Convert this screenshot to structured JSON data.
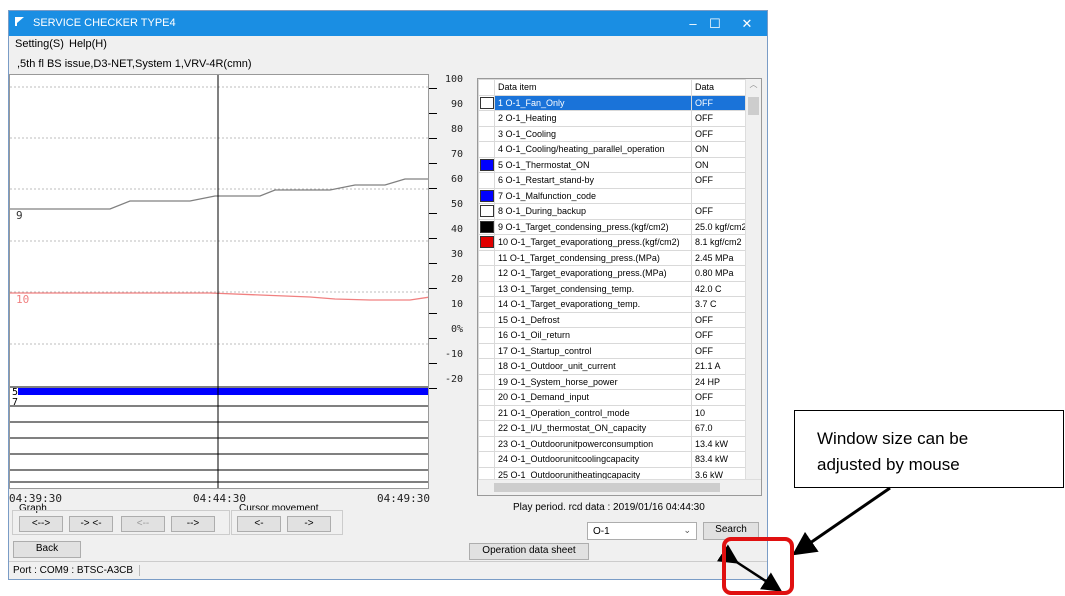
{
  "window": {
    "title": "SERVICE CHECKER TYPE4",
    "controls": [
      "–",
      "☐",
      "✕"
    ]
  },
  "menu": {
    "setting": "Setting(S)",
    "help": "Help(H)"
  },
  "info_line": ",5th fl BS issue,D3-NET,System 1,VRV-4R(cmn)",
  "graph": {
    "y_ticks": [
      "100",
      "90",
      "80",
      "70",
      "60",
      "50",
      "40",
      "30",
      "20",
      "10",
      "0%",
      "-10",
      "-20"
    ],
    "x_labels": [
      "04:39:30",
      "04:44:30",
      "04:49:30"
    ],
    "trace_labels": [
      "9",
      "10",
      "5",
      "7"
    ],
    "colors": {
      "trace9": "#808080",
      "trace10": "#f08080",
      "trace5": "#0000ff"
    }
  },
  "table": {
    "headers": [
      "Data item",
      "Data"
    ],
    "rows": [
      {
        "item": "1 O-1_Fan_Only",
        "value": "OFF",
        "swatch": "#ffffff",
        "selected": true
      },
      {
        "item": "2 O-1_Heating",
        "value": "OFF",
        "swatch": ""
      },
      {
        "item": "3 O-1_Cooling",
        "value": "OFF",
        "swatch": ""
      },
      {
        "item": "4 O-1_Cooling/heating_parallel_operation",
        "value": "ON",
        "swatch": ""
      },
      {
        "item": "5 O-1_Thermostat_ON",
        "value": "ON",
        "swatch": "#0000ff"
      },
      {
        "item": "6 O-1_Restart_stand-by",
        "value": "OFF",
        "swatch": ""
      },
      {
        "item": "7 O-1_Malfunction_code",
        "value": "",
        "swatch": "#0000ff"
      },
      {
        "item": "8 O-1_During_backup",
        "value": "OFF",
        "swatch": "#ffffff"
      },
      {
        "item": "9 O-1_Target_condensing_press.(kgf/cm2)",
        "value": "25.0 kgf/cm2",
        "swatch": "#000000"
      },
      {
        "item": "10 O-1_Target_evaporationg_press.(kgf/cm2)",
        "value": "8.1 kgf/cm2",
        "swatch": "#e00000"
      },
      {
        "item": "11 O-1_Target_condensing_press.(MPa)",
        "value": "2.45 MPa",
        "swatch": ""
      },
      {
        "item": "12 O-1_Target_evaporationg_press.(MPa)",
        "value": "0.80 MPa",
        "swatch": ""
      },
      {
        "item": "13 O-1_Target_condensing_temp.",
        "value": "42.0 C",
        "swatch": ""
      },
      {
        "item": "14 O-1_Target_evaporationg_temp.",
        "value": "3.7 C",
        "swatch": ""
      },
      {
        "item": "15 O-1_Defrost",
        "value": "OFF",
        "swatch": ""
      },
      {
        "item": "16 O-1_Oil_return",
        "value": "OFF",
        "swatch": ""
      },
      {
        "item": "17 O-1_Startup_control",
        "value": "OFF",
        "swatch": ""
      },
      {
        "item": "18 O-1_Outdoor_unit_current",
        "value": "21.1 A",
        "swatch": ""
      },
      {
        "item": "19 O-1_System_horse_power",
        "value": "24 HP",
        "swatch": ""
      },
      {
        "item": "20 O-1_Demand_input",
        "value": "OFF",
        "swatch": ""
      },
      {
        "item": "21 O-1_Operation_control_mode",
        "value": "10",
        "swatch": ""
      },
      {
        "item": "22 O-1_I/U_thermostat_ON_capacity",
        "value": "67.0",
        "swatch": ""
      },
      {
        "item": "23 O-1_Outdoorunitpowerconsumption",
        "value": "13.4 kW",
        "swatch": ""
      },
      {
        "item": "24 O-1_Outdoorunitcoolingcapacity",
        "value": "83.4 kW",
        "swatch": ""
      },
      {
        "item": "25 O-1_Outdoorunitheatingcapacity",
        "value": "3.6 kW",
        "swatch": ""
      }
    ]
  },
  "play_period": "Play period. rcd data : 2019/01/16 04:44:30",
  "graph_controls": {
    "label": "Graph",
    "buttons": [
      "<-->",
      "-> <-",
      "<--",
      "-->"
    ]
  },
  "cursor_controls": {
    "label": "Cursor movement",
    "buttons": [
      "<-",
      "->"
    ]
  },
  "unit_select": {
    "value": "O-1"
  },
  "search_label": "Search",
  "back_label": "Back",
  "sheet_label": "Operation data sheet",
  "status_text": "Port : COM9 : BTSC-A3CB",
  "callout": {
    "line1": "Window size can be",
    "line2": "adjusted by mouse"
  }
}
